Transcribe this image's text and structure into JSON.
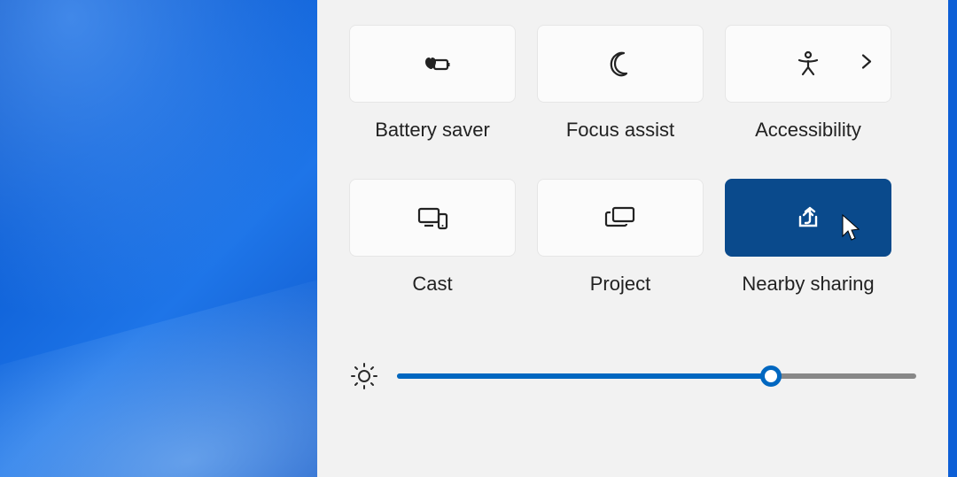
{
  "tiles": [
    {
      "id": "battery-saver",
      "label": "Battery saver",
      "active": false,
      "has_chevron": false
    },
    {
      "id": "focus-assist",
      "label": "Focus assist",
      "active": false,
      "has_chevron": false
    },
    {
      "id": "accessibility",
      "label": "Accessibility",
      "active": false,
      "has_chevron": true
    },
    {
      "id": "cast",
      "label": "Cast",
      "active": false,
      "has_chevron": false
    },
    {
      "id": "project",
      "label": "Project",
      "active": false,
      "has_chevron": false
    },
    {
      "id": "nearby-sharing",
      "label": "Nearby sharing",
      "active": true,
      "has_chevron": false
    }
  ],
  "brightness": {
    "value_percent": 72
  },
  "colors": {
    "accent": "#0067c0",
    "active_tile": "#0a4a8c",
    "panel_bg": "#f2f2f2",
    "tile_bg": "#fbfbfb"
  }
}
